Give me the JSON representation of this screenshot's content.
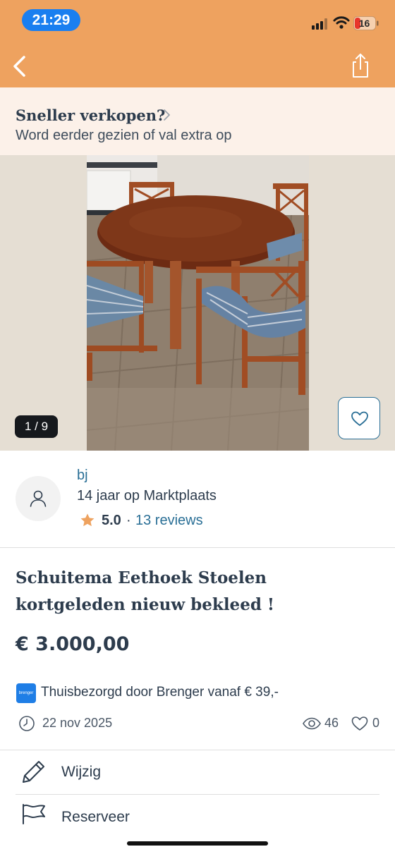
{
  "status_bar": {
    "time": "21:29",
    "battery": "16"
  },
  "header": {
    "back_icon": "chevron-left-icon",
    "share_icon": "share-icon"
  },
  "promo": {
    "title": "Sneller verkopen?",
    "subtitle": "Word eerder gezien of val extra op"
  },
  "gallery": {
    "counter": "1 / 9"
  },
  "seller": {
    "name": "bj",
    "since": "14 jaar op Marktplaats",
    "rating": "5.0",
    "separator": "·",
    "reviews": "13 reviews"
  },
  "listing": {
    "title": "Schuitema Eethoek Stoelen kortgeleden nieuw bekleed !",
    "price": "€ 3.000,00",
    "delivery_logo": "brenger",
    "delivery": "Thuisbezorgd door Brenger vanaf € 39,-",
    "date": "22 nov 2025",
    "views": "46",
    "likes": "0"
  },
  "actions": [
    {
      "label": "Wijzig",
      "icon": "pencil-icon"
    },
    {
      "label": "Reserveer",
      "icon": "flag-icon"
    }
  ],
  "colors": {
    "header": "#eea25f",
    "promo_bg": "#fcf1e9",
    "link": "#2a6f96",
    "star": "#eea25f",
    "status_pill": "#1a7ff0"
  }
}
